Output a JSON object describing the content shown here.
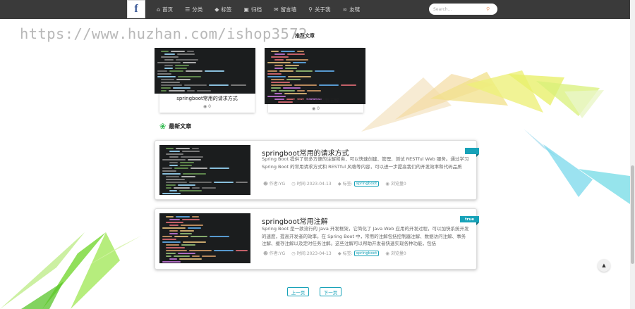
{
  "nav": {
    "logo_letter": "f",
    "items": [
      {
        "icon": "home-icon",
        "glyph": "⌂",
        "label": "首页"
      },
      {
        "icon": "list-icon",
        "glyph": "☰",
        "label": "分类"
      },
      {
        "icon": "tag-icon",
        "glyph": "◆",
        "label": "标签"
      },
      {
        "icon": "archive-icon",
        "glyph": "▣",
        "label": "归档"
      },
      {
        "icon": "chat-icon",
        "glyph": "✉",
        "label": "留言墙"
      },
      {
        "icon": "info-icon",
        "glyph": "⚲",
        "label": "关于我"
      },
      {
        "icon": "link-icon",
        "glyph": "∞",
        "label": "友链"
      }
    ],
    "search_placeholder": "Search..."
  },
  "watermark": "https://www.huzhan.com/ishop3572",
  "recommended": {
    "title": "推荐文章",
    "cards": [
      {
        "title": "springboot常用的请求方式",
        "views": "0"
      },
      {
        "title": "springboot常用注解",
        "views": "0"
      }
    ]
  },
  "latest": {
    "title": "最新文章",
    "posts": [
      {
        "title": "springboot常用的请求方式",
        "desc": "Spring Boot 提供了很多方便的注解和类，可以快速创建、管理、测试 RESTful Web 服务。通过学习 Spring Boot 的常用请求方式和 RESTful 风格等内容，可以进一步提高我们的开发效率和代码品质",
        "author": "作者:YG",
        "time": "时间:2023-04-13",
        "tag_label": "标签:",
        "tag": "springboot",
        "views": "浏览量0",
        "ribbon": ""
      },
      {
        "title": "springboot常用注解",
        "desc": "Spring Boot 是一款流行的 Java 开发框架，它简化了 Java Web 应用的开发过程，可以加快系统开发的速度，提高开发者的效率。在 Spring Boot 中，常用的注解包括控制器注解、数据访问注解、事务注解、缓存注解以及定时任务注解。这些注解可以帮助开发者快速实现各种功能，包括",
        "author": "作者:YG",
        "time": "时间:2023-04-13",
        "tag_label": "标签:",
        "tag": "springboot",
        "views": "浏览量0",
        "ribbon": "true"
      }
    ]
  },
  "pager": {
    "prev": "上一页",
    "next": "下一页"
  },
  "colors": {
    "accent": "#17a2b8",
    "navbar": "#3a3a3a",
    "leaf": "#2db84b"
  }
}
